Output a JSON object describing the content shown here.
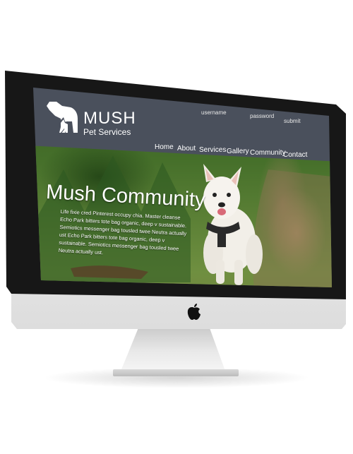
{
  "brand": {
    "name": "MUSH",
    "tagline": "Pet Services",
    "logo_icon": "dog-cat-silhouette-icon"
  },
  "login": {
    "username_placeholder": "username",
    "password_placeholder": "password",
    "submit_label": "submit"
  },
  "nav": {
    "items": [
      {
        "label": "Home"
      },
      {
        "label": "About"
      },
      {
        "label": "Services"
      },
      {
        "label": "Gallery"
      },
      {
        "label": "Community"
      },
      {
        "label": "Contact"
      }
    ]
  },
  "hero": {
    "title": "Mush Community",
    "body": "Life fixie cred Pinterest occupy chia. Master cleanse Echo Park bitters tote bag organic, deep v sustainable. Semiotics messenger bag tousled twee Neutra actually ust Echo Park bitters tote bag organic, deep v sustainable. Semiotics messenger bag tousled twee Neutra actually ust."
  },
  "device": {
    "logo_icon": "apple-logo-icon"
  },
  "colors": {
    "header_bg": "#4a505c",
    "bezel": "#171717",
    "text": "#ffffff"
  }
}
